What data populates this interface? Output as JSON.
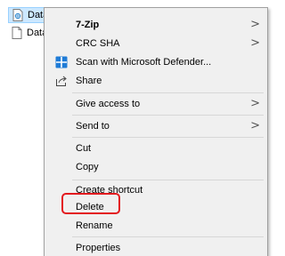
{
  "files": [
    {
      "name": "Data",
      "selected": true
    },
    {
      "name": "Data",
      "selected": false
    }
  ],
  "menu": {
    "items": [
      {
        "id": "7zip",
        "label": "7-Zip",
        "bold": true,
        "submenu": true
      },
      {
        "id": "crc-sha",
        "label": "CRC SHA",
        "submenu": true
      },
      {
        "id": "scan-defender",
        "label": "Scan with Microsoft Defender...",
        "icon": "defender-shield-icon"
      },
      {
        "id": "share",
        "label": "Share",
        "icon": "share-icon"
      },
      {
        "id": "give-access",
        "label": "Give access to",
        "submenu": true
      },
      {
        "id": "send-to",
        "label": "Send to",
        "submenu": true
      },
      {
        "id": "cut",
        "label": "Cut"
      },
      {
        "id": "copy",
        "label": "Copy"
      },
      {
        "id": "create-shortcut",
        "label": "Create shortcut"
      },
      {
        "id": "delete",
        "label": "Delete",
        "highlighted": true
      },
      {
        "id": "rename",
        "label": "Rename"
      },
      {
        "id": "properties",
        "label": "Properties"
      }
    ],
    "submenu_arrow": ">"
  },
  "colors": {
    "highlight_ring": "#e3191e",
    "selection_bg": "#cce8ff",
    "menu_bg": "#f0f0f0"
  }
}
